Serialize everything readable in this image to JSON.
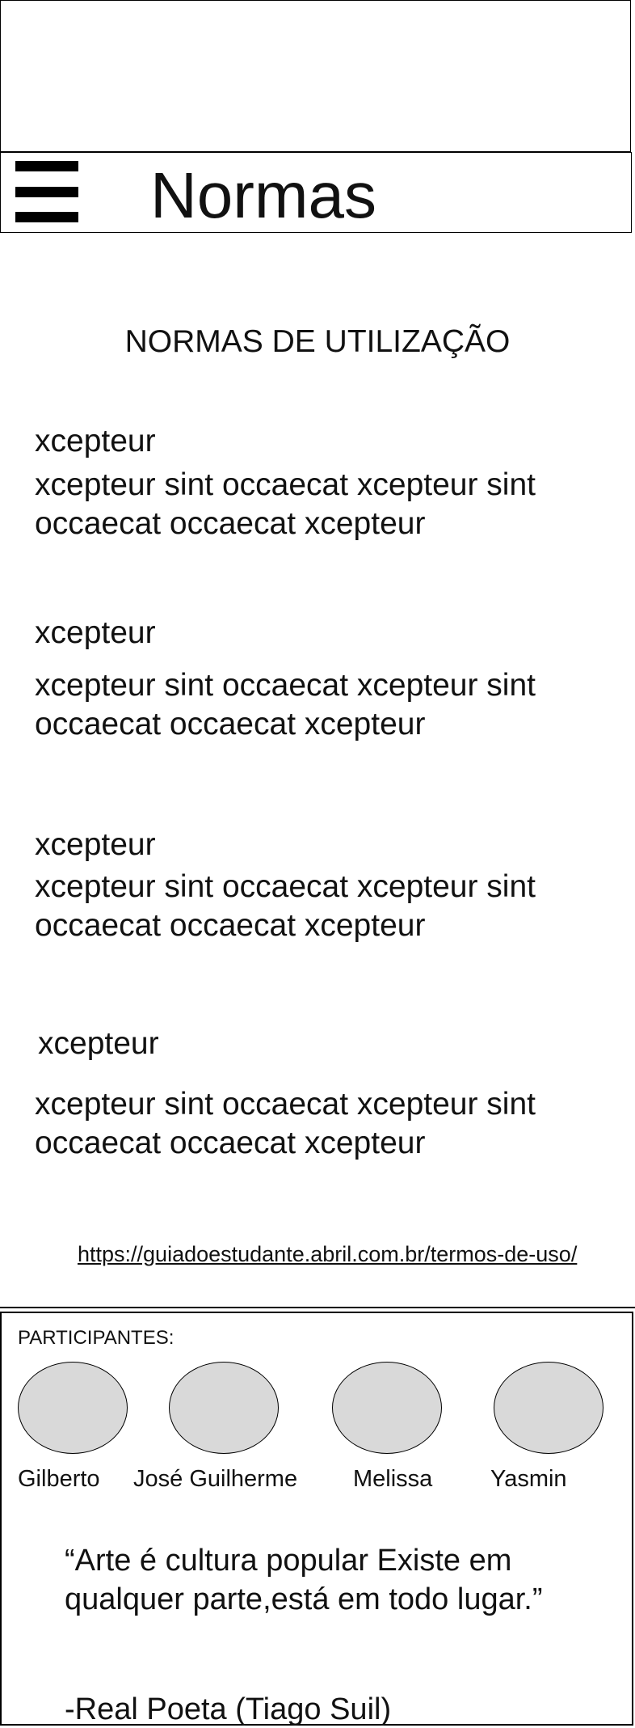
{
  "header": {
    "title": "Normas"
  },
  "page": {
    "heading": "NORMAS DE UTILIZAÇÃO"
  },
  "rules": [
    {
      "title": "xcepteur",
      "text": "xcepteur sint occaecat xcepteur sint occaecat occaecat xcepteur"
    },
    {
      "title": "xcepteur",
      "text": "xcepteur sint occaecat xcepteur sint occaecat occaecat xcepteur"
    },
    {
      "title": "xcepteur",
      "text": "xcepteur sint occaecat xcepteur sint occaecat occaecat xcepteur"
    },
    {
      "title": "xcepteur",
      "text": "xcepteur sint occaecat xcepteur sint occaecat occaecat xcepteur"
    }
  ],
  "source": {
    "link": "https://guiadoestudante.abril.com.br/termos-de-uso/"
  },
  "footer": {
    "participants_label": "PARTICIPANTES:",
    "participants": [
      "Gilberto",
      "José Guilherme",
      "Melissa",
      "Yasmin"
    ],
    "quote": "“Arte é cultura popular Existe em qualquer parte,está em todo lugar.”",
    "quote_author": "-Real Poeta (Tiago Suil)"
  },
  "icons": {
    "menu": "hamburger-menu-icon",
    "avatar": "avatar-placeholder"
  },
  "colors": {
    "avatar_fill": "#d9d9d9",
    "border": "#000000"
  }
}
